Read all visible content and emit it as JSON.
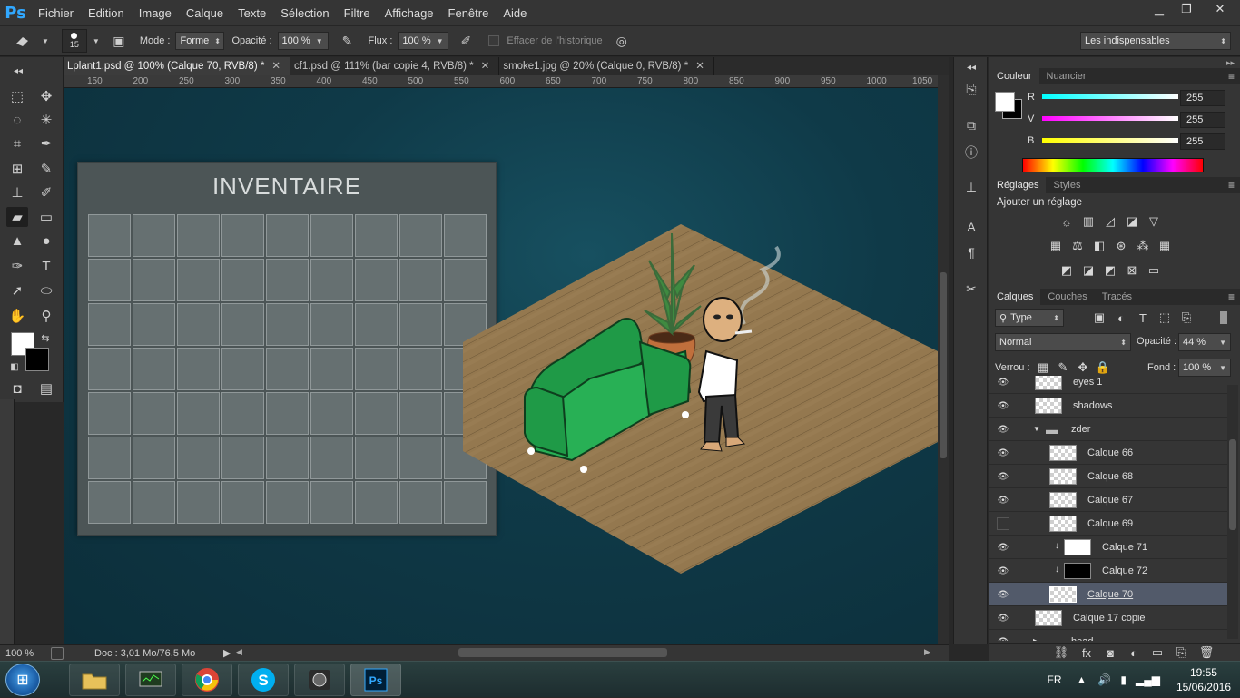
{
  "app": {
    "logo": "Ps"
  },
  "menu": [
    "Fichier",
    "Edition",
    "Image",
    "Calque",
    "Texte",
    "Sélection",
    "Filtre",
    "Affichage",
    "Fenêtre",
    "Aide"
  ],
  "window_controls": {
    "minimize": "▁",
    "restore": "❐",
    "close": "✕"
  },
  "options": {
    "brush_size": "15",
    "mode_label": "Mode :",
    "mode_value": "Forme",
    "opacity_label": "Opacité :",
    "opacity_value": "100 %",
    "flux_label": "Flux :",
    "flux_value": "100 %",
    "history_label": "Effacer de l'historique",
    "workspace": "Les indispensables"
  },
  "tabs": [
    {
      "label": "Lplant1.psd @ 100% (Calque 70, RVB/8) *",
      "close": "✕"
    },
    {
      "label": "cf1.psd @ 111% (bar copie 4, RVB/8) *",
      "close": "✕"
    },
    {
      "label": "smoke1.jpg @ 20% (Calque 0, RVB/8) *",
      "close": "✕"
    }
  ],
  "ruler_ticks": [
    "150",
    "200",
    "250",
    "300",
    "350",
    "400",
    "450",
    "500",
    "550",
    "600",
    "650",
    "700",
    "750",
    "800",
    "850",
    "900",
    "950",
    "1000",
    "1050"
  ],
  "canvas": {
    "inventory_title": "INVENTAIRE",
    "grid_cols": 9,
    "grid_rows": 7
  },
  "status": {
    "zoom": "100 %",
    "doc": "Doc : 3,01 Mo/76,5 Mo"
  },
  "color_panel": {
    "tabs": [
      "Couleur",
      "Nuancier"
    ],
    "channels": [
      {
        "label": "R",
        "value": "255",
        "color": "#00ffff"
      },
      {
        "label": "V",
        "value": "255",
        "color": "#ff00ff"
      },
      {
        "label": "B",
        "value": "255",
        "color": "#ffff00"
      }
    ]
  },
  "adjust_panel": {
    "tabs": [
      "Réglages",
      "Styles"
    ],
    "heading": "Ajouter un réglage"
  },
  "layers_panel": {
    "tabs": [
      "Calques",
      "Couches",
      "Tracés"
    ],
    "filter": "Type",
    "blend": "Normal",
    "opacity_label": "Opacité :",
    "opacity_value": "44 %",
    "lock_label": "Verrou :",
    "fill_label": "Fond :",
    "fill_value": "100 %",
    "layers": [
      {
        "name": "eyes 1",
        "thumb": "checker",
        "visible": true
      },
      {
        "name": "shadows",
        "thumb": "checker",
        "visible": true
      },
      {
        "name": "zder",
        "thumb": "folder",
        "visible": true
      },
      {
        "name": "Calque 66",
        "thumb": "checker",
        "visible": true
      },
      {
        "name": "Calque 68",
        "thumb": "checker",
        "visible": true
      },
      {
        "name": "Calque 67",
        "thumb": "checker",
        "visible": true
      },
      {
        "name": "Calque 69",
        "thumb": "checker",
        "visible": false
      },
      {
        "name": "Calque 71",
        "thumb": "white",
        "visible": true
      },
      {
        "name": "Calque 72",
        "thumb": "black",
        "visible": true
      },
      {
        "name": "Calque 70",
        "thumb": "checker",
        "visible": true,
        "selected": true
      },
      {
        "name": "Calque 17 copie",
        "thumb": "checker",
        "visible": true
      },
      {
        "name": "head",
        "thumb": "folder",
        "visible": true
      }
    ]
  },
  "taskbar": {
    "apps": [
      "explorer",
      "task-manager",
      "chrome",
      "skype",
      "media",
      "photoshop"
    ],
    "lang": "FR",
    "time": "19:55",
    "date": "15/06/2016"
  }
}
